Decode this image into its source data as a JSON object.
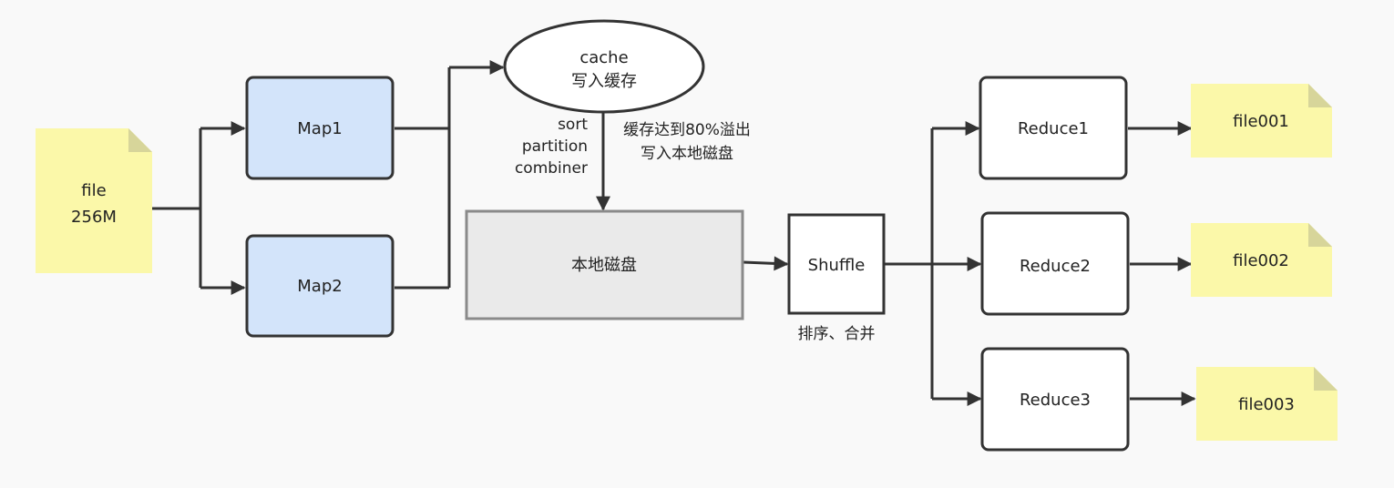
{
  "nodes": {
    "file_input": {
      "line1": "file",
      "line2": "256M"
    },
    "map1": {
      "label": "Map1"
    },
    "map2": {
      "label": "Map2"
    },
    "cache": {
      "line1": "cache",
      "line2": "写入缓存"
    },
    "local_disk": {
      "label": "本地磁盘"
    },
    "shuffle": {
      "label": "Shuffle"
    },
    "reduce1": {
      "label": "Reduce1"
    },
    "reduce2": {
      "label": "Reduce2"
    },
    "reduce3": {
      "label": "Reduce3"
    },
    "file001": {
      "label": "file001"
    },
    "file002": {
      "label": "file002"
    },
    "file003": {
      "label": "file003"
    }
  },
  "labels": {
    "sort_steps": [
      "sort",
      "partition",
      "combiner"
    ],
    "spill": [
      "缓存达到80%溢出",
      "写入本地磁盘"
    ],
    "shuffle_note": "排序、合并"
  },
  "colors": {
    "note_fill": "#fbf8a9",
    "note_fold": "#d7d59a",
    "map_fill": "#d3e4fa",
    "disk_fill": "#eaeaea",
    "stroke": "#333333"
  }
}
